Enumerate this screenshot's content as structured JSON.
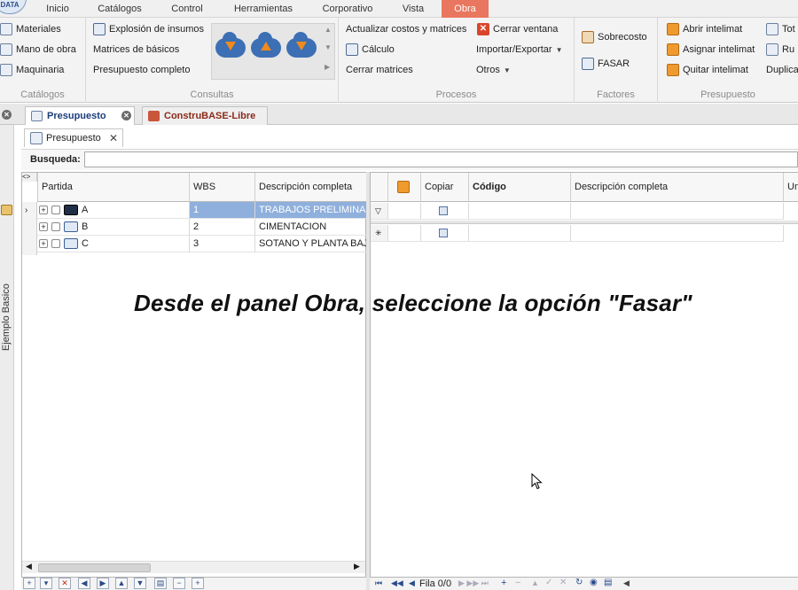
{
  "app": {
    "logo_text": "DATA"
  },
  "menu": [
    "Inicio",
    "Catálogos",
    "Control",
    "Herramientas",
    "Corporativo",
    "Vista",
    "Obra"
  ],
  "ribbon": {
    "catalogos": {
      "title": "Catálogos",
      "items": [
        "Materiales",
        "Mano de obra",
        "Maquinaria"
      ]
    },
    "consultas": {
      "title": "Consultas",
      "items": [
        "Explosión de insumos",
        "Matrices de básicos",
        "Presupuesto completo"
      ]
    },
    "procesos": {
      "title": "Procesos",
      "items": [
        "Actualizar costos y matrices",
        "Cálculo",
        "Cerrar matrices",
        "Cerrar ventana",
        "Importar/Exportar",
        "Otros"
      ]
    },
    "factores": {
      "title": "Factores",
      "items": [
        "Sobrecosto",
        "FASAR"
      ]
    },
    "presupuesto": {
      "title": "Presupuesto",
      "items": [
        "Abrir intelimat",
        "Asignar intelimat",
        "Quitar intelimat",
        "Tot",
        "Ru",
        "Duplica"
      ]
    }
  },
  "doc_tabs": [
    "Presupuesto",
    "ConstruBASE-Libre"
  ],
  "side_panel_label": "Ejemplo Basico",
  "sub_tab": "Presupuesto",
  "search": {
    "label": "Busqueda:",
    "value": ""
  },
  "left_grid": {
    "nav_marker": "<>",
    "columns": [
      "Partida",
      "WBS",
      "Descripción completa"
    ],
    "rows": [
      {
        "partida": "A",
        "wbs": "1",
        "descripcion": "TRABAJOS PRELIMINARES"
      },
      {
        "partida": "B",
        "wbs": "2",
        "descripcion": "CIMENTACION"
      },
      {
        "partida": "C",
        "wbs": "3",
        "descripcion": "SOTANO Y PLANTA BAJA"
      }
    ]
  },
  "right_grid": {
    "columns": [
      "Copiar",
      "Código",
      "Descripción completa",
      "Un"
    ],
    "pager": "Fila 0/0"
  },
  "caption": "Desde el panel Obra, seleccione la opción \"Fasar\""
}
